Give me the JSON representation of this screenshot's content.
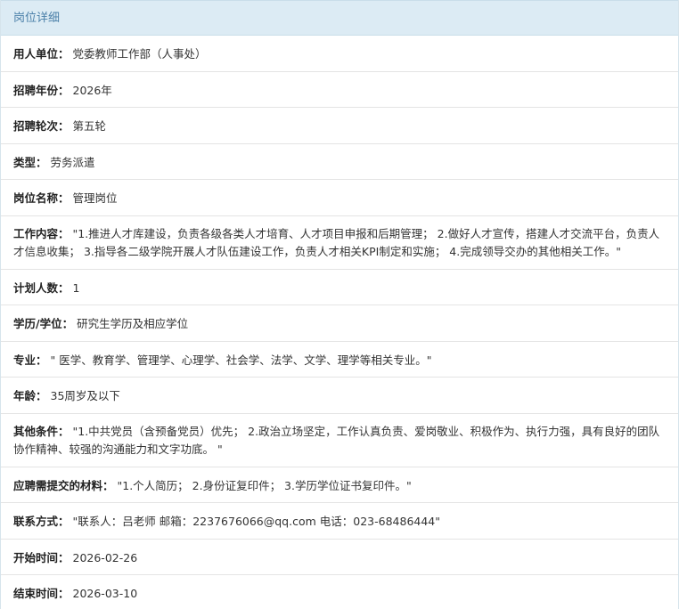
{
  "panel": {
    "title": "岗位详细"
  },
  "fields": [
    {
      "label": "用人单位：",
      "value": "党委教师工作部（人事处）"
    },
    {
      "label": "招聘年份：",
      "value": "2026年"
    },
    {
      "label": "招聘轮次：",
      "value": "第五轮"
    },
    {
      "label": "类型：",
      "value": "劳务派遣"
    },
    {
      "label": "岗位名称：",
      "value": "管理岗位"
    },
    {
      "label": "工作内容：",
      "value": "\"1.推进人才库建设，负责各级各类人才培育、人才项目申报和后期管理； 2.做好人才宣传，搭建人才交流平台，负责人才信息收集； 3.指导各二级学院开展人才队伍建设工作，负责人才相关KPI制定和实施； 4.完成领导交办的其他相关工作。\""
    },
    {
      "label": "计划人数：",
      "value": "1"
    },
    {
      "label": "学历/学位：",
      "value": "研究生学历及相应学位"
    },
    {
      "label": "专业：",
      "value": "\" 医学、教育学、管理学、心理学、社会学、法学、文学、理学等相关专业。\""
    },
    {
      "label": "年龄：",
      "value": "35周岁及以下"
    },
    {
      "label": "其他条件：",
      "value": "\"1.中共党员（含预备党员）优先； 2.政治立场坚定，工作认真负责、爱岗敬业、积极作为、执行力强，具有良好的团队协作精神、较强的沟通能力和文字功底。 \""
    },
    {
      "label": "应聘需提交的材料：",
      "value": "\"1.个人简历； 2.身份证复印件； 3.学历学位证书复印件。\""
    },
    {
      "label": "联系方式：",
      "value": "\"联系人：吕老师 邮箱：2237676066@qq.com 电话：023-68486444\""
    },
    {
      "label": "开始时间：",
      "value": "2026-02-26"
    },
    {
      "label": "结束时间：",
      "value": "2026-03-10"
    }
  ]
}
